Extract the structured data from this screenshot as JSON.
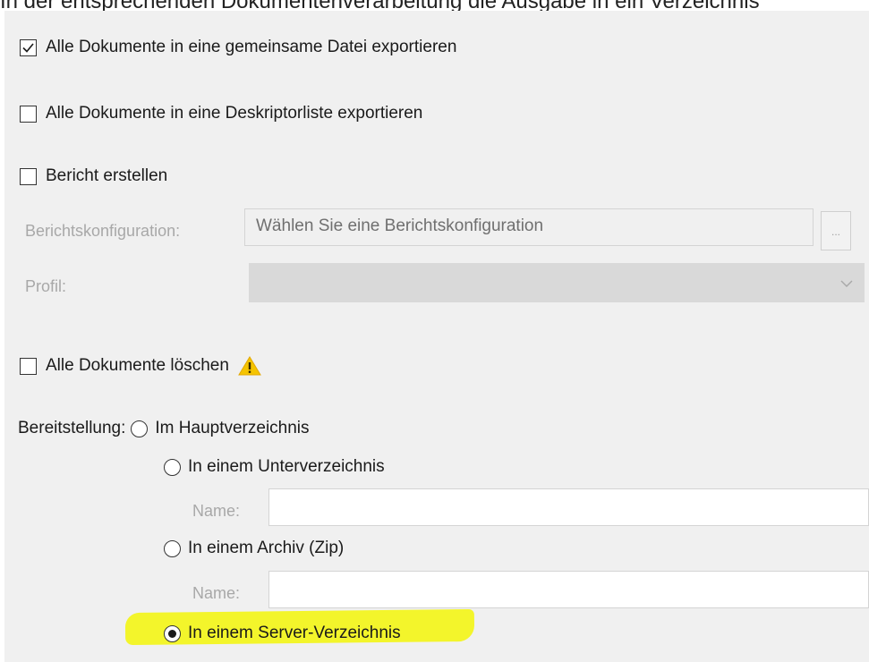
{
  "caption": {
    "text": "In der entsprechenden Dokumentenverarbeitung die Ausgabe in ein Verzeichnis"
  },
  "options": {
    "export_common_file": {
      "label": "Alle Dokumente in eine gemeinsame Datei exportieren",
      "checked": true
    },
    "export_descriptor_list": {
      "label": "Alle Dokumente in eine Deskriptorliste exportieren",
      "checked": false
    },
    "create_report": {
      "label": "Bericht erstellen",
      "checked": false
    },
    "delete_all": {
      "label": "Alle Dokumente löschen",
      "checked": false,
      "warning_icon": "warning-icon"
    }
  },
  "report": {
    "config_label": "Berichtskonfiguration:",
    "config_placeholder": "Wählen Sie eine Berichtskonfiguration",
    "browse_label": "...",
    "profile_label": "Profil:",
    "profile_value": ""
  },
  "provision": {
    "label": "Bereitstellung:",
    "main_dir": "Im Hauptverzeichnis",
    "sub_dir": "In einem Unterverzeichnis",
    "sub_dir_name_label": "Name:",
    "sub_dir_name_value": "",
    "archive": "In einem Archiv (Zip)",
    "archive_name_label": "Name:",
    "archive_name_value": "",
    "server_dir": "In einem Server-Verzeichnis",
    "selected": "server_dir"
  },
  "colors": {
    "panel_bg": "#f0f0f0",
    "highlight": "#f3f52b",
    "warning": "#f5c400"
  }
}
